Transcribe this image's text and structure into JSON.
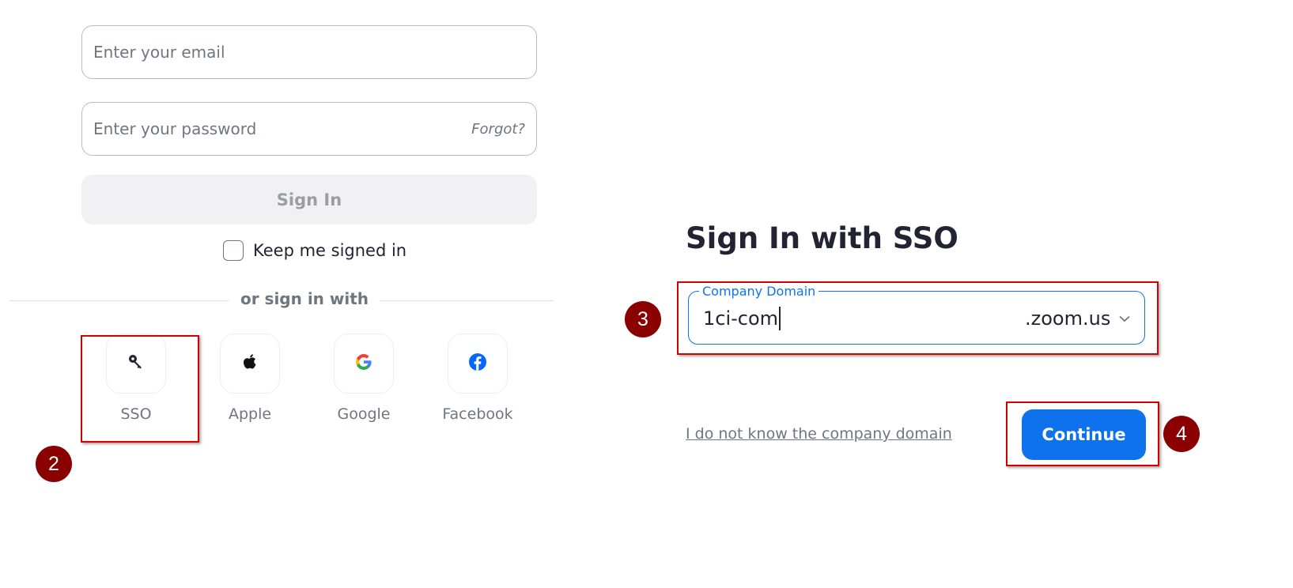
{
  "signin_form": {
    "email_placeholder": "Enter your email",
    "password_placeholder": "Enter your password",
    "forgot_label": "Forgot?",
    "signin_label": "Sign In",
    "keep_signed_in_label": "Keep me signed in",
    "keep_signed_in_checked": false,
    "divider_text": "or sign in with",
    "social": [
      {
        "label": "SSO",
        "icon": "key-icon"
      },
      {
        "label": "Apple",
        "icon": "apple-icon"
      },
      {
        "label": "Google",
        "icon": "google-icon"
      },
      {
        "label": "Facebook",
        "icon": "facebook-icon"
      }
    ]
  },
  "sso_panel": {
    "title": "Sign In with SSO",
    "domain_label": "Company Domain",
    "domain_value": "1ci-com",
    "domain_suffix": ".zoom.us",
    "unknown_domain_link": "I do not know the company domain",
    "continue_label": "Continue"
  },
  "annotations": {
    "step_2": "2",
    "step_3": "3",
    "step_4": "4"
  },
  "colors": {
    "accent_blue": "#0e72ed",
    "annotation_red": "#d40000",
    "marker_dark_red": "#8b0000",
    "facebook_blue": "#0866ff"
  }
}
